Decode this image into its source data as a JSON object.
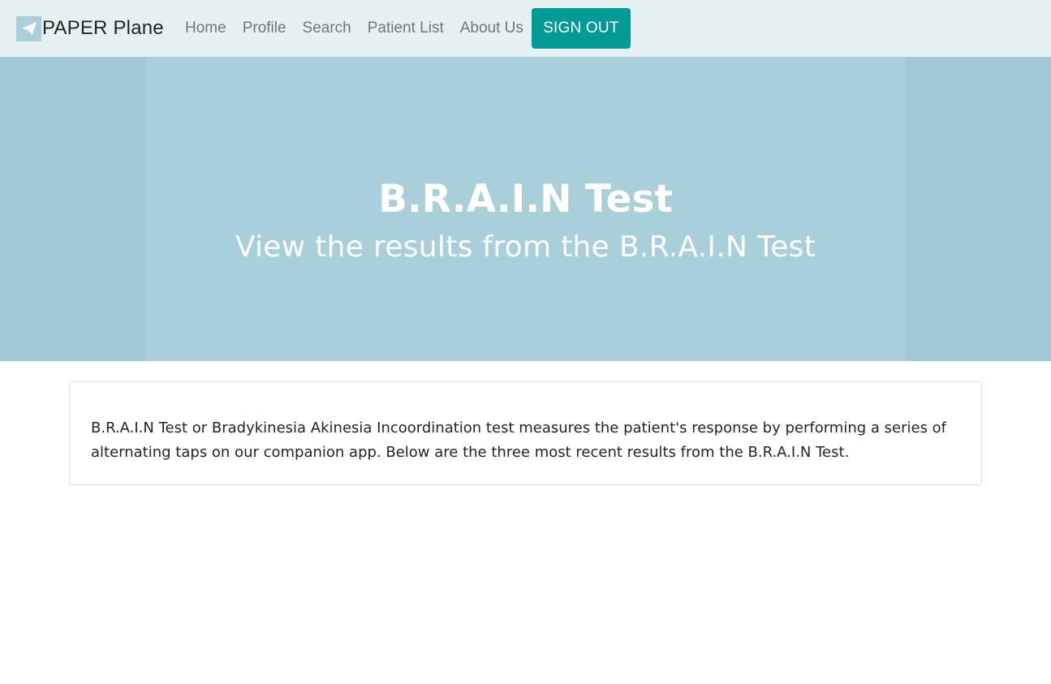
{
  "navbar": {
    "brand_name": "PAPER Plane",
    "brand_icon": "paper-plane-icon",
    "links": [
      {
        "label": "Home"
      },
      {
        "label": "Profile"
      },
      {
        "label": "Search"
      },
      {
        "label": "Patient List"
      },
      {
        "label": "About Us"
      }
    ],
    "signout_label": "SIGN OUT"
  },
  "hero": {
    "title": "B.R.A.I.N Test",
    "subtitle": "View the results from the B.R.A.I.N Test"
  },
  "content": {
    "description": "B.R.A.I.N Test or Bradykinesia Akinesia Incoordination test measures the patient's response by performing a series of alternating taps on our companion app. Below are the three most recent results from the B.R.A.I.N Test."
  },
  "colors": {
    "navbar_bg": "#e6eff2",
    "accent": "#009a97",
    "hero_bg": "#a8cfda",
    "hero_side_bg": "#9fc8d2"
  }
}
